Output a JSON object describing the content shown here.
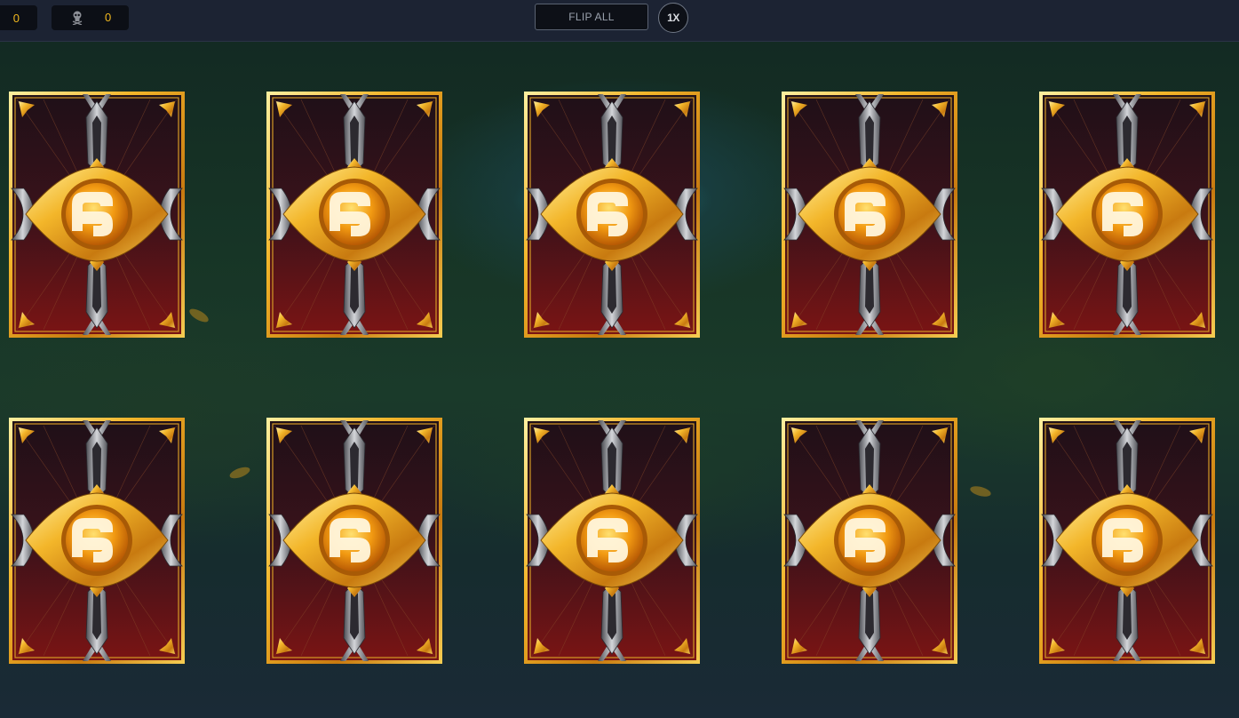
{
  "header": {
    "counter_primary": "0",
    "counter_secondary": "0",
    "counter_secondary_icon": "skull-icon",
    "flip_all_label": "FLIP ALL",
    "speed_label": "1X"
  },
  "cards": [
    {
      "state": "face-down"
    },
    {
      "state": "face-down"
    },
    {
      "state": "face-down"
    },
    {
      "state": "face-down"
    },
    {
      "state": "face-down"
    },
    {
      "state": "face-down"
    },
    {
      "state": "face-down"
    },
    {
      "state": "face-down"
    },
    {
      "state": "face-down"
    },
    {
      "state": "face-down"
    }
  ],
  "colors": {
    "accent_gold": "#f2b91e",
    "card_top": "#2a1418",
    "card_bottom": "#6e1414",
    "header_bg": "#1c2333"
  }
}
